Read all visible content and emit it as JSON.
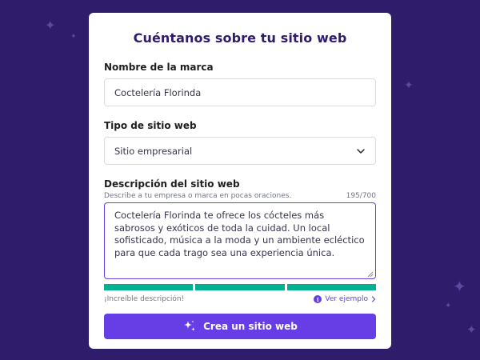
{
  "colors": {
    "background": "#2f1c6a",
    "accent": "#673de6",
    "success": "#00b090",
    "text": "#36344d"
  },
  "form": {
    "title": "Cuéntanos sobre tu sitio web",
    "brand": {
      "label": "Nombre de la marca",
      "value": "Coctelería Florinda"
    },
    "site_type": {
      "label": "Tipo de sitio web",
      "selected": "Sitio empresarial",
      "icon": "chevron-down-icon"
    },
    "description": {
      "label": "Descripción del sitio web",
      "hint": "Describe a tu empresa o marca en pocas oraciones.",
      "counter": "195/700",
      "value": "Coctelería Florinda te ofrece los cócteles más sabrosos y exóticos de toda la cuidad. Un local sofisticado, música a la moda y un ambiente ecléctico para que cada trago sea una experiencia única."
    },
    "quality": {
      "segments_filled": 3,
      "segments_total": 3,
      "message": "¡Increíble descripción!",
      "example_link": "Ver ejemplo",
      "info_icon": "info-icon",
      "arrow_icon": "chevron-right-icon"
    },
    "submit": {
      "label": "Crea un sitio web",
      "icon": "sparkles-icon"
    }
  }
}
